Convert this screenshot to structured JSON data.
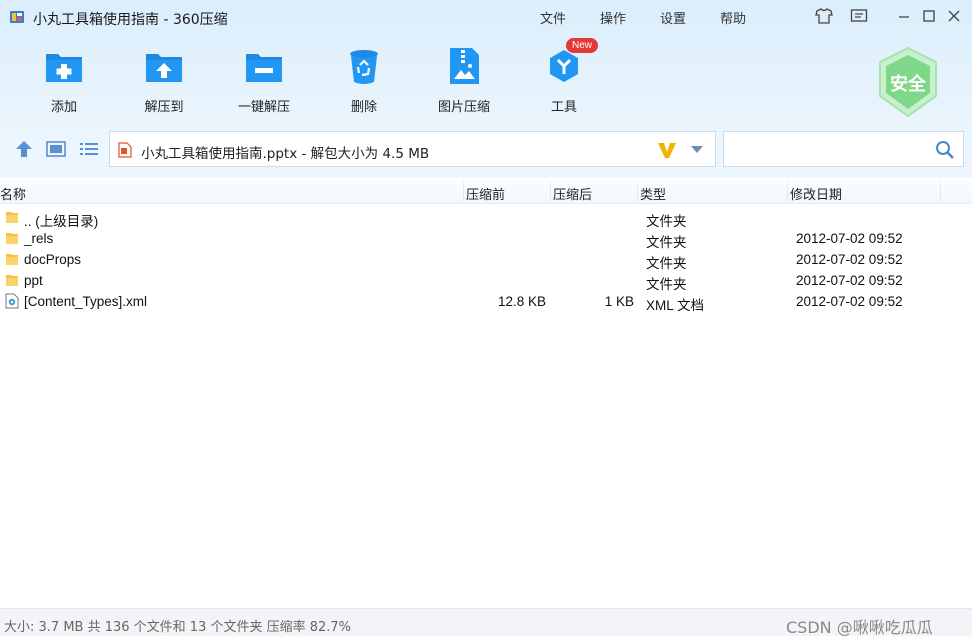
{
  "window": {
    "title": "小丸工具箱使用指南 - 360压缩",
    "menu": [
      "文件",
      "操作",
      "设置",
      "帮助"
    ]
  },
  "toolbar": {
    "items": [
      {
        "label": "添加",
        "icon": "add-icon"
      },
      {
        "label": "解压到",
        "icon": "extract-to-icon"
      },
      {
        "label": "一键解压",
        "icon": "one-click-extract-icon"
      },
      {
        "label": "删除",
        "icon": "delete-icon"
      },
      {
        "label": "图片压缩",
        "icon": "image-compress-icon"
      },
      {
        "label": "工具",
        "icon": "tools-icon",
        "badge": "New"
      }
    ],
    "security_badge": "安全"
  },
  "address": {
    "path": "小丸工具箱使用指南.pptx - 解包大小为 4.5 MB"
  },
  "columns": {
    "name": "名称",
    "compressed_before": "压缩前",
    "compressed_after": "压缩后",
    "type": "类型",
    "modified": "修改日期"
  },
  "files": [
    {
      "name": ".. (上级目录)",
      "before": "",
      "after": "",
      "type": "文件夹",
      "date": "",
      "icon": "folder-icon"
    },
    {
      "name": "_rels",
      "before": "",
      "after": "",
      "type": "文件夹",
      "date": "2012-07-02 09:52",
      "icon": "folder-icon"
    },
    {
      "name": "docProps",
      "before": "",
      "after": "",
      "type": "文件夹",
      "date": "2012-07-02 09:52",
      "icon": "folder-icon"
    },
    {
      "name": "ppt",
      "before": "",
      "after": "",
      "type": "文件夹",
      "date": "2012-07-02 09:52",
      "icon": "folder-icon"
    },
    {
      "name": "[Content_Types].xml",
      "before": "12.8 KB",
      "after": "1 KB",
      "type": "XML 文档",
      "date": "2012-07-02 09:52",
      "icon": "xml-file-icon"
    }
  ],
  "status": {
    "text": "大小: 3.7 MB 共 136 个文件和 13 个文件夹 压缩率 82.7%",
    "watermark": "CSDN @啾啾吃瓜瓜"
  },
  "colors": {
    "accent_blue": "#1e88e5",
    "header_bg": "#dbeefc",
    "folder": "#f5c33b",
    "new_badge": "#e53935",
    "shield_green": "#6fd27a"
  }
}
